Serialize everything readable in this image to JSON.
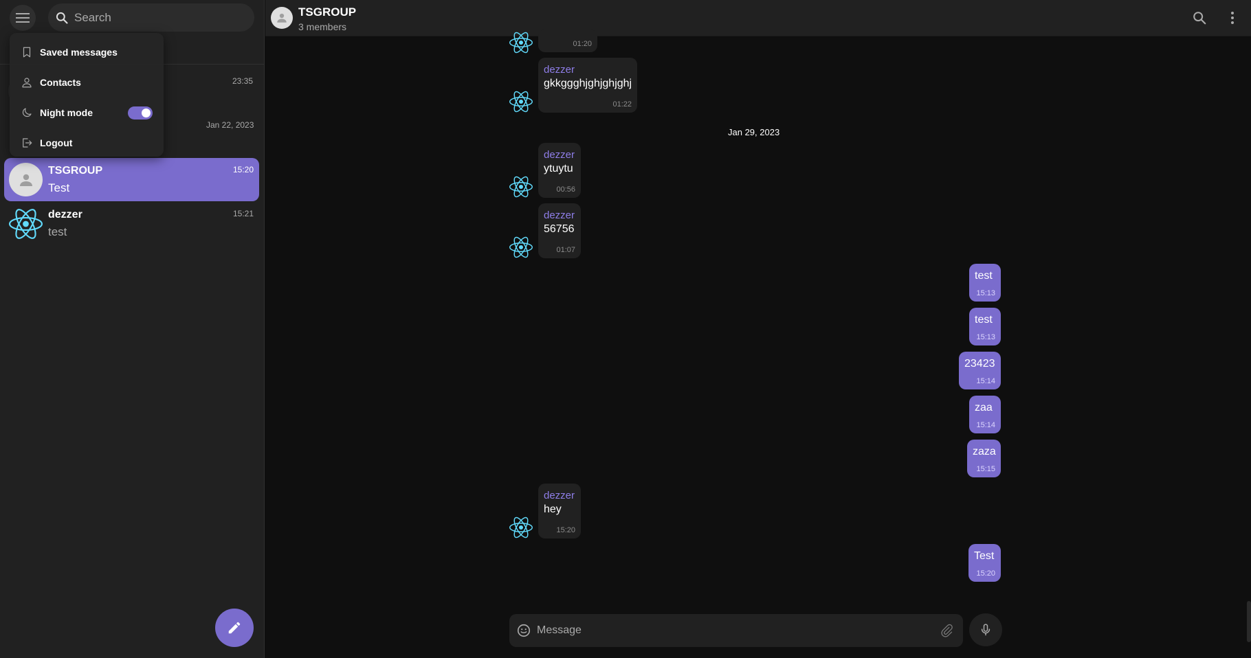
{
  "sidebar": {
    "search_placeholder": "Search",
    "side_times": [
      "23:35",
      "Jan 22, 2023"
    ],
    "chats": [
      {
        "name": "TSGROUP",
        "last": "Test",
        "time": "15:20",
        "active": true
      },
      {
        "name": "dezzer",
        "last": "test",
        "time": "15:21",
        "active": false
      }
    ]
  },
  "menu": {
    "items": [
      {
        "label": "Saved messages",
        "icon": "bookmark-icon"
      },
      {
        "label": "Contacts",
        "icon": "user-icon"
      },
      {
        "label": "Night mode",
        "icon": "moon-icon",
        "toggle": true
      },
      {
        "label": "Logout",
        "icon": "logout-icon"
      }
    ],
    "night_mode_enabled": true
  },
  "header": {
    "title": "TSGROUP",
    "subtitle": "3 members"
  },
  "messages": {
    "partial_top_time": "01:20",
    "date_separator": "Jan 29, 2023",
    "items": [
      {
        "dir": "in",
        "sender": "dezzer",
        "text": "gkkggghjghjghjghj",
        "time": "01:22"
      },
      {
        "dir": "in",
        "sender": "dezzer",
        "text": "ytuytu",
        "time": "00:56"
      },
      {
        "dir": "in",
        "sender": "dezzer",
        "text": "56756",
        "time": "01:07"
      },
      {
        "dir": "out",
        "text": "test",
        "time": "15:13"
      },
      {
        "dir": "out",
        "text": "test",
        "time": "15:13"
      },
      {
        "dir": "out",
        "text": "23423",
        "time": "15:14"
      },
      {
        "dir": "out",
        "text": "zaa",
        "time": "15:14"
      },
      {
        "dir": "out",
        "text": "zaza",
        "time": "15:15"
      },
      {
        "dir": "in",
        "sender": "dezzer",
        "text": "hey",
        "time": "15:20"
      },
      {
        "dir": "out",
        "text": "Test",
        "time": "15:20"
      }
    ]
  },
  "composer": {
    "placeholder": "Message"
  },
  "colors": {
    "accent": "#7a6ccd",
    "sender_name": "#8f7ee8",
    "react_logo": "#61dafb",
    "background": "#0f0f0f",
    "panel": "#212121"
  }
}
